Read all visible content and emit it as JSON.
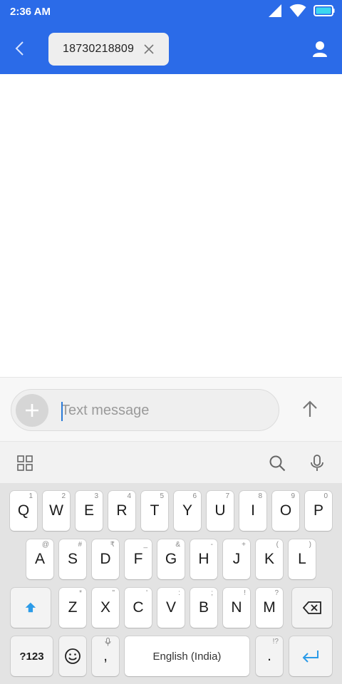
{
  "status": {
    "time": "2:36 AM"
  },
  "header": {
    "recipient_chip": "18730218809"
  },
  "compose": {
    "placeholder": "Text message"
  },
  "keyboard": {
    "row1": [
      {
        "label": "Q",
        "hint": "1"
      },
      {
        "label": "W",
        "hint": "2"
      },
      {
        "label": "E",
        "hint": "3"
      },
      {
        "label": "R",
        "hint": "4"
      },
      {
        "label": "T",
        "hint": "5"
      },
      {
        "label": "Y",
        "hint": "6"
      },
      {
        "label": "U",
        "hint": "7"
      },
      {
        "label": "I",
        "hint": "8"
      },
      {
        "label": "O",
        "hint": "9"
      },
      {
        "label": "P",
        "hint": "0"
      }
    ],
    "row2": [
      {
        "label": "A",
        "hint": "@"
      },
      {
        "label": "S",
        "hint": "#"
      },
      {
        "label": "D",
        "hint": "₹"
      },
      {
        "label": "F",
        "hint": "_"
      },
      {
        "label": "G",
        "hint": "&"
      },
      {
        "label": "H",
        "hint": "-"
      },
      {
        "label": "J",
        "hint": "+"
      },
      {
        "label": "K",
        "hint": "("
      },
      {
        "label": "L",
        "hint": ")"
      }
    ],
    "row3": [
      {
        "label": "Z",
        "hint": "*"
      },
      {
        "label": "X",
        "hint": "\""
      },
      {
        "label": "C",
        "hint": "'"
      },
      {
        "label": "V",
        "hint": ":"
      },
      {
        "label": "B",
        "hint": ";"
      },
      {
        "label": "N",
        "hint": "!"
      },
      {
        "label": "M",
        "hint": "?"
      }
    ],
    "symbols_label": "?123",
    "comma_label": ",",
    "space_label": "English (India)",
    "period_label": ".",
    "period_hint": "!?"
  },
  "colors": {
    "header_bg": "#2b6be8",
    "accent": "#2b9be8"
  },
  "icons": {
    "back": "chevron-left-icon",
    "close": "close-icon",
    "contact": "person-icon",
    "add": "plus-icon",
    "send": "arrow-up-icon",
    "apps": "grid-icon",
    "search": "search-icon",
    "mic": "mic-icon",
    "shift": "shift-icon",
    "backspace": "backspace-icon",
    "emoji": "emoji-icon",
    "enter": "enter-icon"
  }
}
